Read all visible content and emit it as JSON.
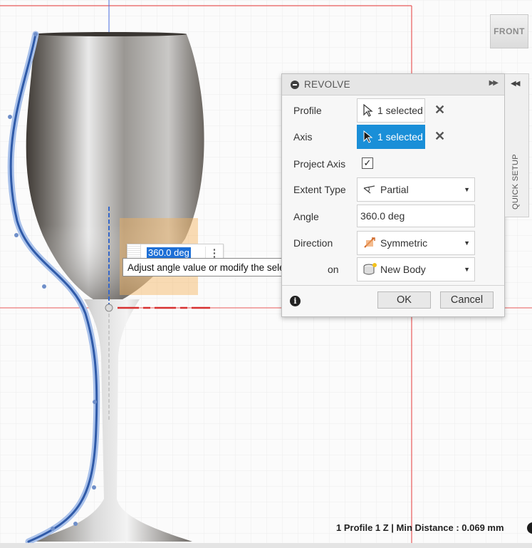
{
  "viewcube": {
    "face_label": "FRONT"
  },
  "canvas_input": {
    "value": "360.0 deg",
    "more_icon": "⋮"
  },
  "tooltip": {
    "text": "Adjust angle value or modify the selection"
  },
  "dialog": {
    "title": "REVOLVE",
    "rows": {
      "profile": {
        "label": "Profile",
        "value": "1 selected"
      },
      "axis": {
        "label": "Axis",
        "value": "1 selected"
      },
      "project_axis": {
        "label": "Project Axis",
        "checked": true
      },
      "extent_type": {
        "label": "Extent Type",
        "value": "Partial"
      },
      "angle": {
        "label": "Angle",
        "value": "360.0 deg"
      },
      "direction": {
        "label": "Direction",
        "value": "Symmetric"
      },
      "operation": {
        "label": "on",
        "value": "New Body"
      }
    },
    "ok_label": "OK",
    "cancel_label": "Cancel",
    "accent_color": "#1a8fd8"
  },
  "side_panel": {
    "label": "QUICK SETUP"
  },
  "status_bar": {
    "text": "1 Profile 1 Z | Min Distance : 0.069 mm"
  }
}
